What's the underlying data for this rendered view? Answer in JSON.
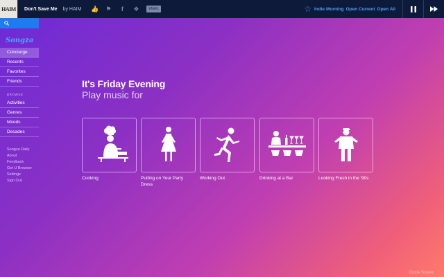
{
  "player": {
    "album_art_text": "HAIM",
    "song_title": "Don't Save Me",
    "artist_line": "by HAIM",
    "share_badge": "EMAIL",
    "station_name": "Indie Morning",
    "open_current_label": "Open Current",
    "open_all_label": "Open All",
    "controls": {
      "pause_icon": "pause-icon",
      "skip_icon": "fast-forward-icon"
    }
  },
  "sidebar": {
    "search_icon": "search-icon",
    "logo": "Songza",
    "primary": [
      {
        "label": "Concierge",
        "active": true
      },
      {
        "label": "Recents"
      },
      {
        "label": "Favorites"
      },
      {
        "label": "Friends"
      }
    ],
    "browse_label": "BROWSE",
    "browse": [
      {
        "label": "Activities"
      },
      {
        "label": "Genres"
      },
      {
        "label": "Moods"
      },
      {
        "label": "Decades"
      }
    ],
    "footer": [
      {
        "label": "Songza Daily"
      },
      {
        "label": "About"
      },
      {
        "label": "Feedback"
      },
      {
        "label": "Get U Browser"
      },
      {
        "label": "Settings"
      },
      {
        "label": "Sign Out"
      }
    ]
  },
  "main": {
    "heading": "It's Friday Evening",
    "subheading": "Play music for",
    "cards": [
      {
        "label": "Cooking",
        "icon": "chef-icon"
      },
      {
        "label": "Putting on Your Party Dress",
        "icon": "party-dress-icon"
      },
      {
        "label": "Working Out",
        "icon": "runner-icon"
      },
      {
        "label": "Drinking at a Bar",
        "icon": "bar-icon"
      },
      {
        "label": "Looking Fresh in the '90s",
        "icon": "nineties-icon"
      }
    ]
  },
  "watermark": "Circle Screen"
}
